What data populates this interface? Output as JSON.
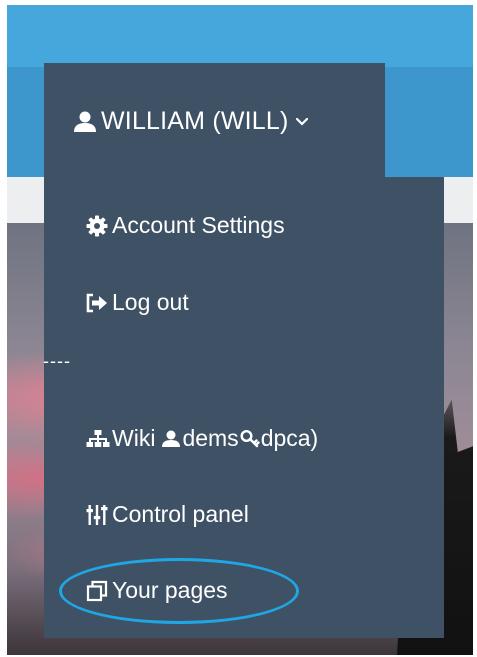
{
  "user_menu": {
    "username": "WILLIAM (WILL)",
    "icons": {
      "user": "user-icon",
      "chevron": "chevron-down-icon"
    }
  },
  "menu": {
    "account_settings": {
      "label": "Account Settings",
      "icon": "gear-icon"
    },
    "log_out": {
      "label": "Log out",
      "icon": "sign-out-icon"
    },
    "divider": "----",
    "wiki": {
      "label_prefix": "Wiki",
      "user": "dems",
      "key": "dpca)",
      "icons": [
        "sitemap-icon",
        "user-icon",
        "key-icon"
      ]
    },
    "control_panel": {
      "label": "Control panel",
      "icon": "sliders-icon"
    },
    "your_pages": {
      "label": "Your pages",
      "icon": "copy-pages-icon"
    }
  },
  "colors": {
    "top_bar": "#45a7dc",
    "nav_strip": "#3d96cc",
    "menu_background": "#3f5265",
    "menu_text": "#ffffff",
    "highlight": "#1ea7e4"
  }
}
